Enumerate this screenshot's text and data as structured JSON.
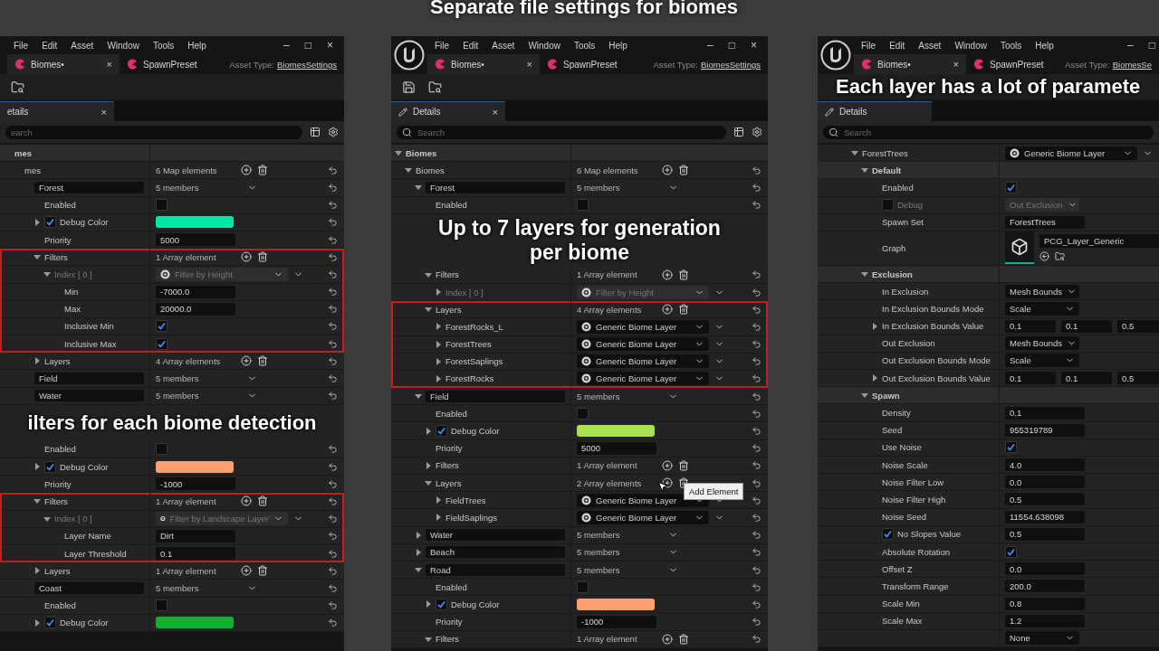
{
  "title": "Separate file settings for biomes",
  "panels": [
    {
      "cut_left": true,
      "cut_right": false,
      "menu": [
        "File",
        "Edit",
        "Asset",
        "Window",
        "Tools",
        "Help"
      ],
      "window_controls": [
        "–",
        "□",
        "×"
      ],
      "tabs": [
        {
          "label": "Biomes•",
          "selected": true,
          "close": "×"
        },
        {
          "label": "SpawnPreset",
          "selected": false
        }
      ],
      "asset_type": {
        "label": "Asset Type:",
        "value": "BiomesSettings"
      },
      "details_tab": {
        "label": "etails",
        "close": "×"
      },
      "search": {
        "placeholder": "earch"
      },
      "rows": [
        {
          "kind": "category",
          "label": "mes",
          "children": [
            {
              "kind": "property",
              "label": "mes",
              "value": {
                "kind": "count",
                "text": "6 Map elements"
              },
              "children": [
                {
                  "kind": "entry",
                  "label": "Forest",
                  "value": {
                    "kind": "members",
                    "text": "5 members"
                  },
                  "children": [
                    {
                      "kind": "property",
                      "label": "Enabled",
                      "value": {
                        "kind": "checkbox",
                        "checked": false
                      }
                    },
                    {
                      "kind": "property",
                      "label": "Debug Color",
                      "expanded": false,
                      "label_checked": true,
                      "value": {
                        "kind": "color",
                        "color": "#00e8a8"
                      }
                    },
                    {
                      "kind": "property",
                      "label": "Priority",
                      "value": {
                        "kind": "field",
                        "text": "5000"
                      }
                    },
                    {
                      "kind": "property",
                      "label": "Filters",
                      "expanded": true,
                      "highlighted": true,
                      "value": {
                        "kind": "count",
                        "text": "1 Array element"
                      },
                      "children": [
                        {
                          "kind": "property",
                          "label": "Index [ 0 ]",
                          "expanded": true,
                          "disabled": true,
                          "value": {
                            "kind": "asset",
                            "text": "Filter by Height"
                          },
                          "children": [
                            {
                              "kind": "property",
                              "label": "Min",
                              "value": {
                                "kind": "field",
                                "text": "-7000.0"
                              }
                            },
                            {
                              "kind": "property",
                              "label": "Max",
                              "value": {
                                "kind": "field",
                                "text": "20000.0"
                              }
                            },
                            {
                              "kind": "property",
                              "label": "Inclusive Min",
                              "value": {
                                "kind": "checkbox",
                                "checked": true
                              }
                            },
                            {
                              "kind": "property",
                              "label": "Inclusive Max",
                              "value": {
                                "kind": "checkbox",
                                "checked": true
                              }
                            }
                          ]
                        }
                      ]
                    },
                    {
                      "kind": "property",
                      "label": "Layers",
                      "expanded": false,
                      "value": {
                        "kind": "count",
                        "text": "4 Array elements"
                      }
                    }
                  ]
                },
                {
                  "kind": "entry",
                  "label": "Field",
                  "value": {
                    "kind": "members",
                    "text": "5 members"
                  }
                },
                {
                  "kind": "entry",
                  "label": "Water",
                  "value": {
                    "kind": "members",
                    "text": "5 members"
                  }
                },
                {
                  "kind": "caption",
                  "text": "ilters for each biome detection",
                  "children": [
                    {
                      "kind": "property",
                      "label": "Enabled",
                      "value": {
                        "kind": "checkbox",
                        "checked": false
                      }
                    },
                    {
                      "kind": "property",
                      "label": "Debug Color",
                      "expanded": false,
                      "label_checked": true,
                      "value": {
                        "kind": "color",
                        "color": "#ffa070"
                      }
                    },
                    {
                      "kind": "property",
                      "label": "Priority",
                      "value": {
                        "kind": "field",
                        "text": "-1000"
                      }
                    },
                    {
                      "kind": "property",
                      "label": "Filters",
                      "expanded": true,
                      "highlighted": true,
                      "value": {
                        "kind": "count",
                        "text": "1 Array element"
                      },
                      "children": [
                        {
                          "kind": "property",
                          "label": "Index [ 0 ]",
                          "expanded": true,
                          "disabled": true,
                          "value": {
                            "kind": "asset",
                            "text": "Filter by Landscape Layer"
                          },
                          "children": [
                            {
                              "kind": "property",
                              "label": "Layer Name",
                              "value": {
                                "kind": "field",
                                "text": "Dirt"
                              }
                            },
                            {
                              "kind": "property",
                              "label": "Layer Threshold",
                              "value": {
                                "kind": "field",
                                "text": "0.1"
                              }
                            }
                          ]
                        }
                      ]
                    },
                    {
                      "kind": "property",
                      "label": "Layers",
                      "expanded": false,
                      "value": {
                        "kind": "count",
                        "text": "1 Array element"
                      }
                    }
                  ]
                },
                {
                  "kind": "entry",
                  "label": "Coast",
                  "value": {
                    "kind": "members",
                    "text": "5 members"
                  },
                  "children": [
                    {
                      "kind": "property",
                      "label": "Enabled",
                      "value": {
                        "kind": "checkbox",
                        "checked": false
                      }
                    },
                    {
                      "kind": "property",
                      "label": "Debug Color",
                      "expanded": false,
                      "label_checked": true,
                      "value": {
                        "kind": "color",
                        "color": "#10b030"
                      }
                    }
                  ]
                }
              ]
            }
          ]
        }
      ]
    },
    {
      "cut_left": false,
      "cut_right": false,
      "menu": [
        "File",
        "Edit",
        "Asset",
        "Window",
        "Tools",
        "Help"
      ],
      "window_controls": [
        "–",
        "□",
        "×"
      ],
      "tabs": [
        {
          "label": "Biomes•",
          "selected": true,
          "close": "×"
        },
        {
          "label": "SpawnPreset",
          "selected": false
        }
      ],
      "asset_type": {
        "label": "Asset Type:",
        "value": "BiomesSettings"
      },
      "details_tab": {
        "label": "Details",
        "close": "×"
      },
      "search": {
        "placeholder": "Search"
      },
      "rows": [
        {
          "kind": "category",
          "label": "Biomes",
          "expanded": true,
          "children": [
            {
              "kind": "property",
              "label": "Biomes",
              "expanded": true,
              "value": {
                "kind": "count",
                "text": "6 Map elements"
              },
              "children": [
                {
                  "kind": "entry",
                  "label": "Forest",
                  "expanded": true,
                  "value": {
                    "kind": "members",
                    "text": "5 members"
                  },
                  "children": [
                    {
                      "kind": "property",
                      "label": "Enabled",
                      "value": {
                        "kind": "checkbox",
                        "checked": false
                      }
                    },
                    {
                      "kind": "caption",
                      "text": "Up to 7 layers for generation per biome"
                    },
                    {
                      "kind": "property",
                      "label": "Filters",
                      "expanded": true,
                      "value": {
                        "kind": "count",
                        "text": "1 Array element"
                      },
                      "children": [
                        {
                          "kind": "property",
                          "label": "Index [ 0 ]",
                          "expanded": false,
                          "disabled": true,
                          "value": {
                            "kind": "asset",
                            "text": "Filter by Height"
                          }
                        }
                      ]
                    },
                    {
                      "kind": "property",
                      "label": "Layers",
                      "expanded": true,
                      "highlighted": true,
                      "value": {
                        "kind": "count",
                        "text": "4 Array elements"
                      },
                      "children": [
                        {
                          "kind": "property",
                          "label": "ForestRocks_L",
                          "expanded": false,
                          "value": {
                            "kind": "asset",
                            "text": "Generic Biome Layer"
                          }
                        },
                        {
                          "kind": "property",
                          "label": "ForestTrees",
                          "expanded": false,
                          "value": {
                            "kind": "asset",
                            "text": "Generic Biome Layer"
                          }
                        },
                        {
                          "kind": "property",
                          "label": "ForestSaplings",
                          "expanded": false,
                          "value": {
                            "kind": "asset",
                            "text": "Generic Biome Layer"
                          }
                        },
                        {
                          "kind": "property",
                          "label": "ForestRocks",
                          "expanded": false,
                          "value": {
                            "kind": "asset",
                            "text": "Generic Biome Layer"
                          }
                        }
                      ]
                    }
                  ]
                },
                {
                  "kind": "entry",
                  "label": "Field",
                  "expanded": true,
                  "value": {
                    "kind": "members",
                    "text": "5 members"
                  },
                  "children": [
                    {
                      "kind": "property",
                      "label": "Enabled",
                      "value": {
                        "kind": "checkbox",
                        "checked": false
                      }
                    },
                    {
                      "kind": "property",
                      "label": "Debug Color",
                      "expanded": false,
                      "label_checked": true,
                      "value": {
                        "kind": "color",
                        "color": "#a8e050"
                      }
                    },
                    {
                      "kind": "property",
                      "label": "Priority",
                      "value": {
                        "kind": "field",
                        "text": "5000"
                      }
                    },
                    {
                      "kind": "property",
                      "label": "Filters",
                      "expanded": false,
                      "value": {
                        "kind": "count",
                        "text": "1 Array element"
                      }
                    },
                    {
                      "kind": "property",
                      "label": "Layers",
                      "expanded": true,
                      "tooltip": "Add Element",
                      "value": {
                        "kind": "count",
                        "text": "2 Array elements"
                      },
                      "children": [
                        {
                          "kind": "property",
                          "label": "FieldTrees",
                          "expanded": false,
                          "value": {
                            "kind": "asset",
                            "text": "Generic Biome Layer"
                          }
                        },
                        {
                          "kind": "property",
                          "label": "FieldSaplings",
                          "expanded": false,
                          "value": {
                            "kind": "asset",
                            "text": "Generic Biome Layer"
                          }
                        }
                      ]
                    }
                  ]
                },
                {
                  "kind": "entry",
                  "label": "Water",
                  "expanded": false,
                  "value": {
                    "kind": "members",
                    "text": "5 members"
                  }
                },
                {
                  "kind": "entry",
                  "label": "Beach",
                  "expanded": false,
                  "value": {
                    "kind": "members",
                    "text": "5 members"
                  }
                },
                {
                  "kind": "entry",
                  "label": "Road",
                  "expanded": true,
                  "value": {
                    "kind": "members",
                    "text": "5 members"
                  },
                  "children": [
                    {
                      "kind": "property",
                      "label": "Enabled",
                      "value": {
                        "kind": "checkbox",
                        "checked": false
                      }
                    },
                    {
                      "kind": "property",
                      "label": "Debug Color",
                      "expanded": false,
                      "label_checked": true,
                      "value": {
                        "kind": "color",
                        "color": "#ffa070"
                      }
                    },
                    {
                      "kind": "property",
                      "label": "Priority",
                      "value": {
                        "kind": "field",
                        "text": "-1000"
                      }
                    },
                    {
                      "kind": "property",
                      "label": "Filters",
                      "expanded": true,
                      "value": {
                        "kind": "count",
                        "text": "1 Array element"
                      }
                    }
                  ]
                }
              ]
            }
          ]
        }
      ]
    },
    {
      "cut_left": false,
      "cut_right": true,
      "menu": [
        "File",
        "Edit",
        "Asset",
        "Window",
        "Tools",
        "Help"
      ],
      "window_controls": [
        "–",
        "□"
      ],
      "tabs": [
        {
          "label": "Biomes•",
          "selected": true,
          "close": "×"
        },
        {
          "label": "SpawnPreset",
          "selected": false
        }
      ],
      "asset_type": {
        "label": "Asset Type:",
        "value": "BiomesSe"
      },
      "caption": "Each layer has a lot of paramete",
      "details_tab": {
        "label": "Details"
      },
      "search": {
        "placeholder": "Search"
      },
      "rows": [
        {
          "kind": "property",
          "label": "ForestTrees",
          "expanded": true,
          "value": {
            "kind": "asset",
            "text": "Generic Biome Layer"
          },
          "children": [
            {
              "kind": "category",
              "label": "Default",
              "expanded": true,
              "children": [
                {
                  "kind": "property",
                  "label": "Enabled",
                  "value": {
                    "kind": "checkbox",
                    "checked": true
                  }
                },
                {
                  "kind": "property",
                  "label": "Debug",
                  "label_checked": false,
                  "disabled": true,
                  "value": {
                    "kind": "dropdown",
                    "text": "Out Exclusion"
                  }
                },
                {
                  "kind": "property",
                  "label": "Spawn Set",
                  "value": {
                    "kind": "field",
                    "text": "ForestTrees"
                  }
                },
                {
                  "kind": "property",
                  "label": "Graph",
                  "value": {
                    "kind": "graph",
                    "text": "PCG_Layer_Generic"
                  }
                }
              ]
            },
            {
              "kind": "category",
              "label": "Exclusion",
              "expanded": true,
              "children": [
                {
                  "kind": "property",
                  "label": "In Exclusion",
                  "value": {
                    "kind": "dropdown",
                    "text": "Mesh Bounds"
                  }
                },
                {
                  "kind": "property",
                  "label": "In Exclusion Bounds Mode",
                  "value": {
                    "kind": "dropdown",
                    "text": "Scale"
                  }
                },
                {
                  "kind": "property",
                  "label": "In Exclusion Bounds Value",
                  "expanded": false,
                  "value": {
                    "kind": "vector",
                    "values": [
                      "0.1",
                      "0.1",
                      "0.5"
                    ]
                  }
                },
                {
                  "kind": "property",
                  "label": "Out Exclusion",
                  "value": {
                    "kind": "dropdown",
                    "text": "Mesh Bounds"
                  }
                },
                {
                  "kind": "property",
                  "label": "Out Exclusion Bounds Mode",
                  "value": {
                    "kind": "dropdown",
                    "text": "Scale"
                  }
                },
                {
                  "kind": "property",
                  "label": "Out Exclusion Bounds Value",
                  "expanded": false,
                  "value": {
                    "kind": "vector",
                    "values": [
                      "0.1",
                      "0.1",
                      "0.5"
                    ]
                  }
                }
              ]
            },
            {
              "kind": "category",
              "label": "Spawn",
              "expanded": true,
              "children": [
                {
                  "kind": "property",
                  "label": "Density",
                  "value": {
                    "kind": "field",
                    "text": "0.1"
                  }
                },
                {
                  "kind": "property",
                  "label": "Seed",
                  "value": {
                    "kind": "field",
                    "text": "955319789"
                  }
                },
                {
                  "kind": "property",
                  "label": "Use Noise",
                  "value": {
                    "kind": "checkbox",
                    "checked": true
                  }
                },
                {
                  "kind": "property",
                  "label": "Noise Scale",
                  "value": {
                    "kind": "field",
                    "text": "4.0"
                  }
                },
                {
                  "kind": "property",
                  "label": "Noise Filter Low",
                  "value": {
                    "kind": "field",
                    "text": "0.0"
                  }
                },
                {
                  "kind": "property",
                  "label": "Noise Filter High",
                  "value": {
                    "kind": "field",
                    "text": "0.5"
                  }
                },
                {
                  "kind": "property",
                  "label": "Noise Seed",
                  "value": {
                    "kind": "field",
                    "text": "11554.638098"
                  }
                },
                {
                  "kind": "property",
                  "label": "No Slopes Value",
                  "label_checked": true,
                  "value": {
                    "kind": "field",
                    "text": "0.5"
                  }
                },
                {
                  "kind": "property",
                  "label": "Absolute Rotation",
                  "value": {
                    "kind": "checkbox",
                    "checked": true
                  }
                },
                {
                  "kind": "property",
                  "label": "Offset Z",
                  "value": {
                    "kind": "field",
                    "text": "0.0"
                  }
                },
                {
                  "kind": "property",
                  "label": "Transform Range",
                  "value": {
                    "kind": "field",
                    "text": "200.0"
                  }
                },
                {
                  "kind": "property",
                  "label": "Scale Min",
                  "value": {
                    "kind": "field",
                    "text": "0.8"
                  }
                },
                {
                  "kind": "property",
                  "label": "Scale Max",
                  "value": {
                    "kind": "field",
                    "text": "1.2"
                  }
                },
                {
                  "kind": "property",
                  "value": {
                    "kind": "dropdown",
                    "text": "None"
                  }
                }
              ]
            }
          ]
        }
      ]
    }
  ]
}
